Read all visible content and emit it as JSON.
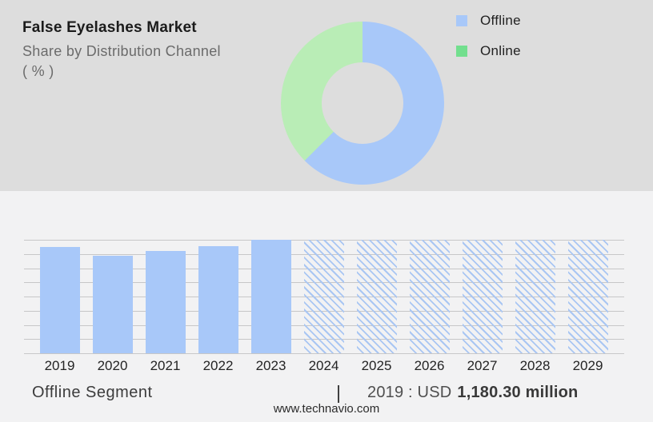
{
  "page": {
    "website": "www.technavio.com"
  },
  "colors": {
    "top_bg": "#dddddd",
    "bottom_bg": "#f2f2f3",
    "gridline": "#c7c7c8",
    "bar_blue": "#a8c8f9",
    "hatch_blue": "#a9c6f3",
    "pie_blue": "#a8c8f9",
    "pie_green": "#b9edb6",
    "legend_blue": "#a8c8f9",
    "legend_green": "#72df8e"
  },
  "header": {
    "title": "False Eyelashes Market",
    "subtitle_line1": "Share by Distribution Channel",
    "subtitle_line2": "( % )"
  },
  "legend": {
    "items": [
      {
        "label": "Offline",
        "color": "#a8c8f9"
      },
      {
        "label": "Online",
        "color": "#72df8e"
      }
    ]
  },
  "footer": {
    "segment_label": "Offline Segment",
    "separator": "|",
    "annotation_prefix": "2019 : USD",
    "annotation_value": "1,180.30 million"
  },
  "chart_data": [
    {
      "type": "pie",
      "subtype": "donut",
      "title": "False Eyelashes Market",
      "subtitle": "Share by Distribution Channel ( % )",
      "labels": [
        "Offline",
        "Online"
      ],
      "values_pct_estimated": [
        62.5,
        37.5
      ],
      "colors": [
        "#a8c8f9",
        "#b9edb6"
      ],
      "start_angle_deg": 0,
      "direction": "clockwise",
      "inner_radius_ratio": 0.5,
      "legend_position": "right"
    },
    {
      "type": "bar",
      "categories": [
        "2019",
        "2020",
        "2021",
        "2022",
        "2023",
        "2024",
        "2025",
        "2026",
        "2027",
        "2028",
        "2029"
      ],
      "series": [
        {
          "name": "Offline Segment",
          "height_frac": [
            0.937,
            0.859,
            0.901,
            0.944,
            1.0,
            1.0,
            1.0,
            1.0,
            1.0,
            1.0,
            1.0
          ],
          "values_usd_million_estimated": [
            1180.3,
            1083,
            1136,
            1189,
            1260,
            null,
            null,
            null,
            null,
            null,
            null
          ]
        }
      ],
      "hatched": [
        false,
        false,
        false,
        false,
        false,
        true,
        true,
        true,
        true,
        true,
        true
      ],
      "forecast_bars_are_full_height_placeholders": true,
      "bar_color": "#a8c8f9",
      "grid_on": true,
      "gridline_count": 9,
      "annotation": "2019 : USD 1,180.30 million",
      "xlabel": "",
      "ylabel": ""
    }
  ]
}
